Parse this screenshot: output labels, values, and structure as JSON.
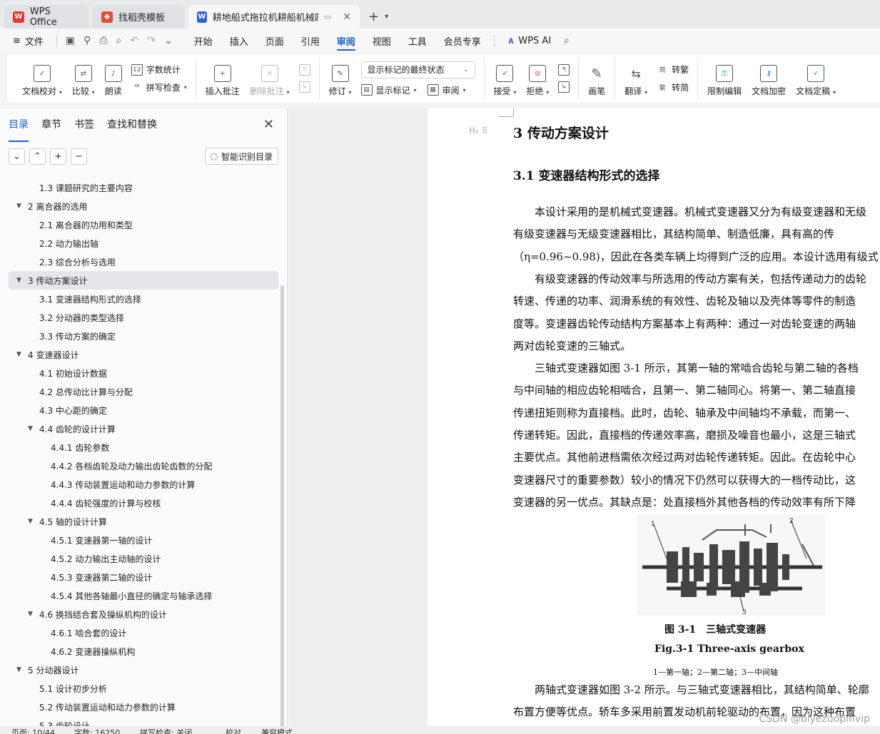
{
  "tabs": [
    {
      "label": "WPS Office",
      "icon": "wps-logo-icon"
    },
    {
      "label": "找稻壳模板",
      "icon": "docer-icon"
    },
    {
      "label": "耕地船式拖拉机耕船机械四驱·",
      "icon": "word-doc-icon"
    }
  ],
  "menu": {
    "file": "文件",
    "items": [
      "开始",
      "插入",
      "页面",
      "引用",
      "审阅",
      "视图",
      "工具",
      "会员专享"
    ],
    "active": "审阅",
    "ai": "WPS AI"
  },
  "ribbon": {
    "doc_check": "文档校对",
    "compare": "比较",
    "read_aloud": "朗读",
    "word_count": "字数统计",
    "spell_check": "拼写检查",
    "insert_comment": "插入批注",
    "delete_comment": "删除批注",
    "track_changes": "修订",
    "display_state": "显示标记的最终状态",
    "show_markup": "显示标记",
    "review_pane": "审阅",
    "accept": "接受",
    "reject": "拒绝",
    "pen": "画笔",
    "translate": "翻译",
    "to_traditional": "转繁",
    "to_simplified": "转简",
    "restrict_edit": "限制编辑",
    "encrypt": "文档加密",
    "finalize": "文档定稿"
  },
  "nav": {
    "tabs": [
      "目录",
      "章节",
      "书签",
      "查找和替换"
    ],
    "smart_toc": "智能识别目录",
    "toc": [
      {
        "text": "1.3 课题研究的主要内容",
        "level": 2
      },
      {
        "text": "2 离合器的选用",
        "level": 1
      },
      {
        "text": "2.1 离合器的功用和类型",
        "level": 2
      },
      {
        "text": "2.2 动力输出轴",
        "level": 2
      },
      {
        "text": "2.3 综合分析与选用",
        "level": 2
      },
      {
        "text": "3  传动方案设计",
        "level": 1,
        "active": true
      },
      {
        "text": "3.1  变速器结构形式的选择",
        "level": 2
      },
      {
        "text": "3.2  分动器的类型选择",
        "level": 2
      },
      {
        "text": "3.3  传动方案的确定",
        "level": 2
      },
      {
        "text": "4  变速器设计",
        "level": 1
      },
      {
        "text": "4.1  初始设计数据",
        "level": 2
      },
      {
        "text": "4.2  总传动比计算与分配",
        "level": 2
      },
      {
        "text": "4.3  中心距的确定",
        "level": 2
      },
      {
        "text": "4.4  齿轮的设计计算",
        "level": 2,
        "expandable": true
      },
      {
        "text": "4.4.1  齿轮参数",
        "level": 3
      },
      {
        "text": "4.4.2  各档齿轮及动力输出齿轮齿数的分配",
        "level": 3
      },
      {
        "text": "4.4.3  传动装置运动和动力参数的计算",
        "level": 3
      },
      {
        "text": "4.4.4  齿轮强度的计算与校核",
        "level": 3
      },
      {
        "text": "4.5  轴的设计计算",
        "level": 2,
        "expandable": true
      },
      {
        "text": "4.5.1  变速器第一轴的设计",
        "level": 3
      },
      {
        "text": "4.5.2  动力输出主动轴的设计",
        "level": 3
      },
      {
        "text": "4.5.3  变速器第二轴的设计",
        "level": 3
      },
      {
        "text": "4.5.4  其他各轴最小直径的确定与轴承选择",
        "level": 3
      },
      {
        "text": "4.6  换挡结合套及操纵机构的设计",
        "level": 2,
        "expandable": true
      },
      {
        "text": "4.6.1  啮合套的设计",
        "level": 3
      },
      {
        "text": "4.6.2  变速器操纵机构",
        "level": 3
      },
      {
        "text": "5  分动器设计",
        "level": 1
      },
      {
        "text": "5.1  设计初步分析",
        "level": 2
      },
      {
        "text": "5.2  传动装置运动和动力参数的计算",
        "level": 2
      },
      {
        "text": "5.3  齿轮设计",
        "level": 2
      }
    ]
  },
  "doc": {
    "heading1": "3  传动方案设计",
    "heading2": "3.1  变速器结构形式的选择",
    "lines": [
      "　　本设计采用的是机械式变速器。机械式变速器又分为有级变速器和无级",
      "有级变速器与无级变速器相比，其结构简单、制造低廉，具有高的传",
      "（η=0.96~0.98)，因此在各类车辆上均得到广泛的应用。本设计选用有级式",
      "　　有级变速器的传动效率与所选用的传动方案有关，包括传递动力的齿轮",
      "转速、传递的功率、润滑系统的有效性、齿轮及轴以及壳体等零件的制造",
      "度等。变速器齿轮传动结构方案基本上有两种：通过一对齿轮变速的两轴",
      "两对齿轮变速的三轴式。",
      "　　三轴式变速器如图 3-1 所示，其第一轴的常啮合齿轮与第二轴的各档",
      "与中间轴的相应齿轮相啮合，且第一、第二轴同心。将第一、第二轴直接",
      "传递扭矩则称为直接档。此时，齿轮、轴承及中间轴均不承载，而第一、",
      "传递转矩。因此，直接档的传递效率高，磨损及噪音也最小，这是三轴式",
      "主要优点。其他前进档需依次经过两对齿轮传递转矩。因此。在齿轮中心",
      "变速器尺寸的重要参数）较小的情况下仍然可以获得大的一档传动比，这",
      "变速器的另一优点。其缺点是：处直接档外其他各档的传动效率有所下降"
    ],
    "figure_caption_cn": "图 3-1　三轴式变速器",
    "figure_caption_en": "Fig.3-1 Three-axis gearbox",
    "figure_note": "1—第一轴；2—第二轴；3—中间轴",
    "figure_labels": [
      "1",
      "2",
      "3"
    ],
    "lines_after": [
      "　　两轴式变速器如图 3-2 所示。与三轴式变速器相比，其结构简单、轮廓",
      "布置方便等优点。轿车多采用前置发动机前轮驱动的布置，因为这种布置"
    ]
  },
  "status": {
    "page": "页面: 10/44",
    "words": "字数: 16250",
    "spell": "拼写检查: 关闭",
    "proof": "校对",
    "mode": "兼容模式"
  },
  "watermark": "CSDN @biyezuopinvip"
}
